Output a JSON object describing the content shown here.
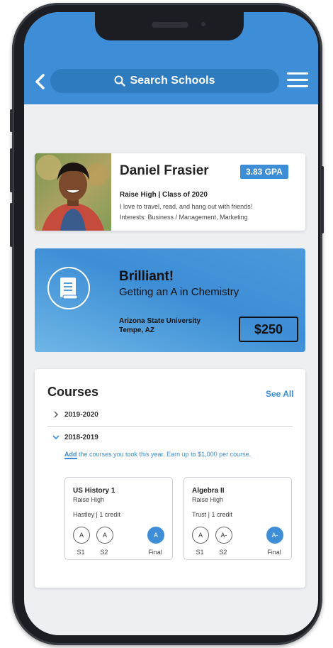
{
  "header": {
    "search_label": "Search Schools"
  },
  "profile": {
    "name": "Daniel Frasier",
    "gpa": "3.83 GPA",
    "school": "Raise High | Class of 2020",
    "bio": "I love to travel, read, and hang out with friends!",
    "interests": "Interests: Business / Management, Marketing"
  },
  "award": {
    "title": "Brilliant!",
    "subtitle": "Getting an A in Chemistry",
    "university": "Arizona State University",
    "location": "Tempe, AZ",
    "amount": "$250"
  },
  "courses": {
    "title": "Courses",
    "see_all": "See All",
    "years": [
      {
        "label": "2019-2020",
        "expanded": false
      },
      {
        "label": "2018-2019",
        "expanded": true
      }
    ],
    "add_link": "Add",
    "add_text": " the courses you took this year. Earn up to $1,000 per course.",
    "items": [
      {
        "title": "US History 1",
        "school": "Raise High",
        "teacher": "Hastley | 1 credit",
        "grades": {
          "s1": "A",
          "s2": "A",
          "final": "A"
        },
        "labels": {
          "s1": "S1",
          "s2": "S2",
          "final": "Final"
        }
      },
      {
        "title": "Algebra II",
        "school": "Raise High",
        "teacher": "Trust | 1 credit",
        "grades": {
          "s1": "A",
          "s2": "A-",
          "final": "A-"
        },
        "labels": {
          "s1": "S1",
          "s2": "S2",
          "final": "Final"
        }
      }
    ]
  },
  "colors": {
    "accent": "#3d8ed6",
    "header_bg": "#3d8ed6",
    "search_bg": "#2f7bc0"
  },
  "icons": {
    "back": "chevron-left-icon",
    "search": "search-icon",
    "menu": "hamburger-menu-icon",
    "award": "book-icon"
  }
}
